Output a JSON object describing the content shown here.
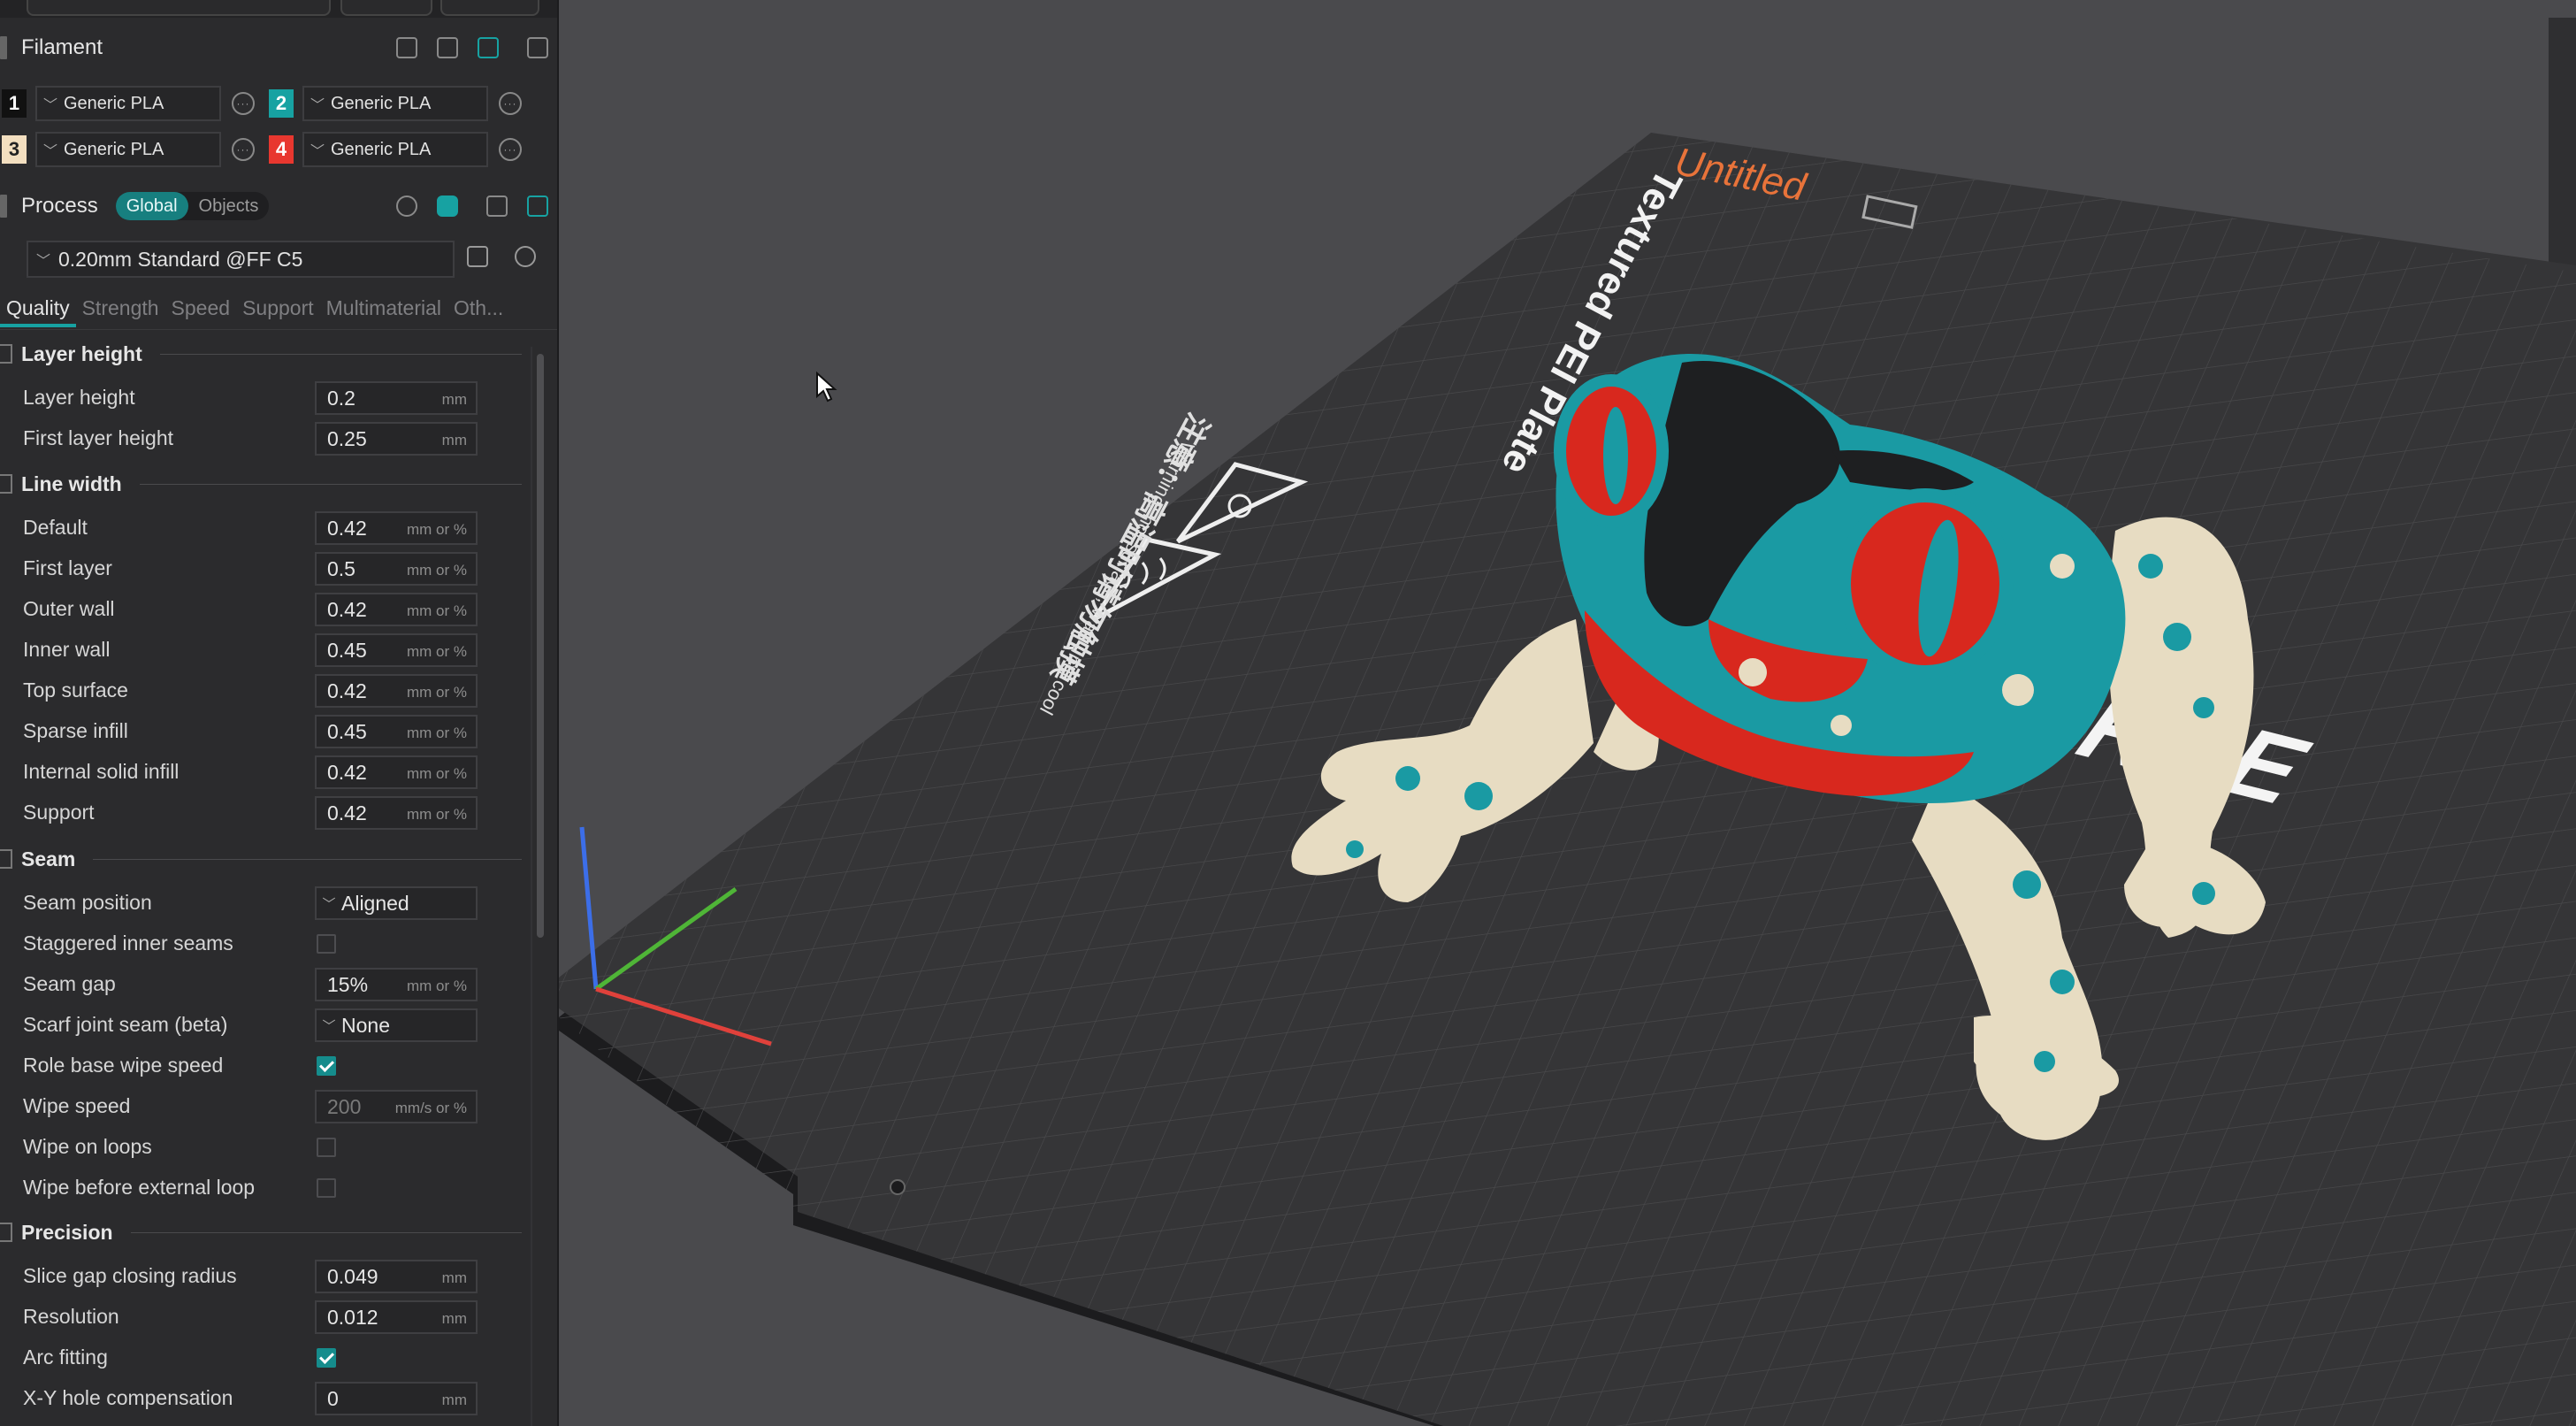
{
  "filament": {
    "title": "Filament",
    "slots": [
      {
        "num": "1",
        "name": "Generic PLA",
        "color": "#111111",
        "text_color": "#ffffff"
      },
      {
        "num": "2",
        "name": "Generic PLA",
        "color": "#17a2a2",
        "text_color": "#ffffff"
      },
      {
        "num": "3",
        "name": "Generic PLA",
        "color": "#f3dfc0",
        "text_color": "#222222"
      },
      {
        "num": "4",
        "name": "Generic PLA",
        "color": "#e8372f",
        "text_color": "#ffffff"
      }
    ]
  },
  "process": {
    "title": "Process",
    "toggle_global": "Global",
    "toggle_objects": "Objects",
    "preset": "0.20mm Standard @FF C5"
  },
  "tabs": [
    "Quality",
    "Strength",
    "Speed",
    "Support",
    "Multimaterial",
    "Oth..."
  ],
  "groups": {
    "layer_height": "Layer height",
    "line_width": "Line width",
    "seam": "Seam",
    "precision": "Precision"
  },
  "rows": {
    "layer_height": {
      "label": "Layer height",
      "value": "0.2",
      "unit": "mm"
    },
    "first_layer_height": {
      "label": "First layer height",
      "value": "0.25",
      "unit": "mm"
    },
    "lw_default": {
      "label": "Default",
      "value": "0.42",
      "unit": "mm or %"
    },
    "lw_first_layer": {
      "label": "First layer",
      "value": "0.5",
      "unit": "mm or %"
    },
    "lw_outer_wall": {
      "label": "Outer wall",
      "value": "0.42",
      "unit": "mm or %"
    },
    "lw_inner_wall": {
      "label": "Inner wall",
      "value": "0.45",
      "unit": "mm or %"
    },
    "lw_top_surface": {
      "label": "Top surface",
      "value": "0.42",
      "unit": "mm or %"
    },
    "lw_sparse_infill": {
      "label": "Sparse infill",
      "value": "0.45",
      "unit": "mm or %"
    },
    "lw_internal_solid": {
      "label": "Internal solid infill",
      "value": "0.42",
      "unit": "mm or %"
    },
    "lw_support": {
      "label": "Support",
      "value": "0.42",
      "unit": "mm or %"
    },
    "seam_position": {
      "label": "Seam position",
      "value": "Aligned"
    },
    "staggered_inner_seams": {
      "label": "Staggered inner seams",
      "checked": false
    },
    "seam_gap": {
      "label": "Seam gap",
      "value": "15%",
      "unit": "mm or %"
    },
    "scarf_joint_seam": {
      "label": "Scarf joint seam (beta)",
      "value": "None"
    },
    "role_base_wipe_speed": {
      "label": "Role base wipe speed",
      "checked": true
    },
    "wipe_speed": {
      "label": "Wipe speed",
      "value": "200",
      "unit": "mm/s or %"
    },
    "wipe_on_loops": {
      "label": "Wipe on loops",
      "checked": false
    },
    "wipe_before_external_loop": {
      "label": "Wipe before external loop",
      "checked": false
    },
    "slice_gap_closing_radius": {
      "label": "Slice gap closing radius",
      "value": "0.049",
      "unit": "mm"
    },
    "resolution": {
      "label": "Resolution",
      "value": "0.012",
      "unit": "mm"
    },
    "arc_fitting": {
      "label": "Arc fitting",
      "checked": true
    },
    "xy_hole_compensation": {
      "label": "X-Y hole compensation",
      "value": "0",
      "unit": "mm"
    }
  },
  "scene": {
    "plate_name": "Untitled",
    "plate_type": "Textured PEI Plate",
    "warning_text": "Warning: hot surface, wait until cool",
    "warning_cn": "注意：高温时请勿触摸",
    "brand": "FORGE",
    "colors": {
      "accent": "#17a2a2",
      "model_teal": "#1a9aa3",
      "model_red": "#d8281e",
      "model_cream": "#e7dcc2",
      "model_black": "#1e1f21",
      "plate_label": "#e8733a"
    }
  }
}
